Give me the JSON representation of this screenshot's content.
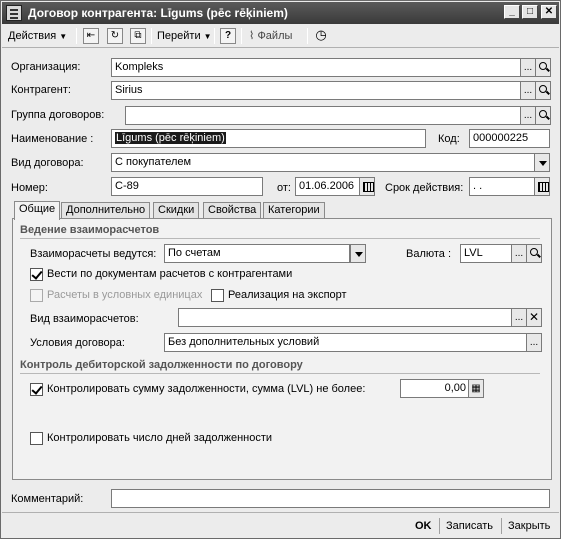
{
  "window": {
    "title": "Договор контрагента: Līgums (pēc rēķiniem)",
    "minimize_glyph": "_",
    "maximize_glyph": "□",
    "close_glyph": "✕"
  },
  "toolbar": {
    "actions_label": "Действия",
    "goto_label": "Перейти",
    "help_label": "?",
    "files_label": "Файлы"
  },
  "form": {
    "organization": {
      "label": "Организация:",
      "value": "Kompleks"
    },
    "counterparty": {
      "label": "Контрагент:",
      "value": "Sirius"
    },
    "contract_group": {
      "label": "Группа договоров:",
      "value": ""
    },
    "name": {
      "label": "Наименование :",
      "value": "Līgums (pēc rēķiniem)"
    },
    "code": {
      "label": "Код:",
      "value": "000000225"
    },
    "contract_type": {
      "label": "Вид договора:",
      "value": "С покупателем"
    },
    "number": {
      "label": "Номер:",
      "value": "C-89"
    },
    "date": {
      "label": "от:",
      "value": "01.06.2006"
    },
    "validity": {
      "label": "Срок действия:",
      "value": " .  . "
    }
  },
  "tabs": [
    {
      "label": "Общие",
      "active": true
    },
    {
      "label": "Дополнительно",
      "active": false
    },
    {
      "label": "Скидки",
      "active": false
    },
    {
      "label": "Свойства",
      "active": false
    },
    {
      "label": "Категории",
      "active": false
    }
  ],
  "general": {
    "settlements_section": "Ведение взаиморасчетов",
    "settlements_by": {
      "label": "Взаиморасчеты ведутся:",
      "value": "По счетам"
    },
    "currency": {
      "label": "Валюта :",
      "value": "LVL"
    },
    "by_documents": {
      "label": "Вести по документам расчетов с контрагентами",
      "checked": true
    },
    "conventional_units": {
      "label": "Расчеты в условных единицах",
      "checked": false,
      "disabled": true
    },
    "export_sale": {
      "label": "Реализация на экспорт",
      "checked": false
    },
    "settlement_kind": {
      "label": "Вид взаиморасчетов:",
      "value": ""
    },
    "contract_terms": {
      "label": "Условия договора:",
      "value": "Без дополнительных условий"
    },
    "control_section": "Контроль дебиторской задолженности по договору",
    "control_sum": {
      "label": "Контролировать сумму задолженности, сумма (LVL) не более:",
      "checked": true,
      "value": "0,00"
    },
    "control_days": {
      "label": "Контролировать число дней задолженности",
      "checked": false
    }
  },
  "comment": {
    "label": "Комментарий:",
    "value": ""
  },
  "buttons": {
    "ok": "OK",
    "save": "Записать",
    "close": "Закрыть"
  }
}
